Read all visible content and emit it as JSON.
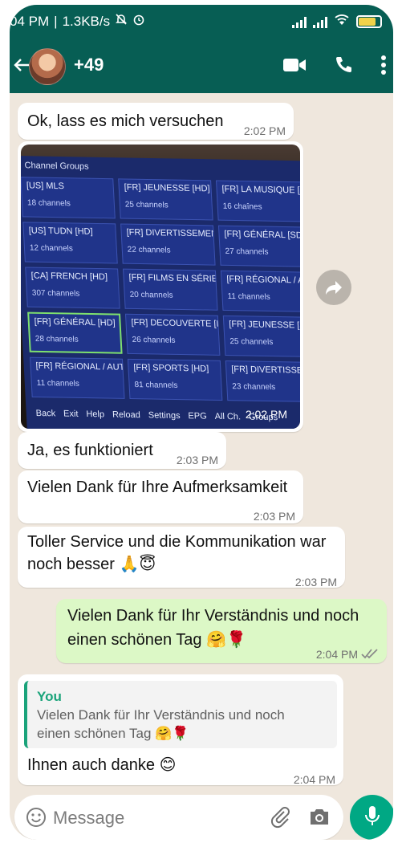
{
  "status": {
    "time": "04 PM",
    "speed": "1.3KB/s",
    "icons": [
      "mute-icon",
      "alarm-icon",
      "signal-icon",
      "signal-icon",
      "wifi-icon",
      "battery-icon"
    ]
  },
  "header": {
    "contact_name": "+49",
    "icons": [
      "back-icon",
      "video-call-icon",
      "voice-call-icon",
      "more-icon"
    ]
  },
  "messages": [
    {
      "text": "Ok, lass es mich versuchen",
      "time": "2:02 PM"
    },
    {
      "text": "Ja, es funktioniert",
      "time": "2:03 PM"
    },
    {
      "text": "Vielen Dank für Ihre Aufmerksamkeit",
      "time": "2:03 PM"
    },
    {
      "line1": "Toller Service und die Kommunikation war",
      "line2": "noch besser 🙏😇",
      "time": "2:03 PM"
    },
    {
      "line1": "Vielen Dank für Ihr Verständnis und noch",
      "line2": "einen schönen Tag 🤗🌹",
      "time": "2:04 PM"
    },
    {
      "quote_author": "You",
      "quote_line1": "Vielen Dank für Ihr Verständnis und noch",
      "quote_line2": "einen schönen Tag 🤗🌹",
      "text": "Ihnen auch danke 😊",
      "time": "2:04 PM"
    }
  ],
  "media": {
    "time": "2:02 PM",
    "tv_title": "Channel Groups",
    "rows": [
      [
        {
          "name": "[US] MLS",
          "count": "18 channels"
        },
        {
          "name": "[FR] JEUNESSE [HD]",
          "count": "25 channels"
        },
        {
          "name": "[FR] LA MUSIQUE [H",
          "count": "16 chaînes"
        }
      ],
      [
        {
          "name": "[US] TUDN [HD]",
          "count": "12 channels"
        },
        {
          "name": "[FR] DIVERTISSEMEN",
          "count": "22 channels"
        },
        {
          "name": "[FR] GÉNÉRAL [SD]",
          "count": "27 channels"
        }
      ],
      [
        {
          "name": "[CA] FRENCH [HD]",
          "count": "307 channels"
        },
        {
          "name": "[FR] FILMS EN SÉRIE",
          "count": "20 channels"
        },
        {
          "name": "[FR] RÉGIONAL / AUT",
          "count": "11 channels"
        }
      ],
      [
        {
          "name": "[FR] GÉNÉRAL [HD]",
          "count": "28 channels"
        },
        {
          "name": "[FR] DECOUVERTE [H",
          "count": "26 channels"
        },
        {
          "name": "[FR] JEUNESSE [SD]",
          "count": "25 channels"
        }
      ],
      [
        {
          "name": "[FR] RÉGIONAL / AUT",
          "count": "11 channels"
        },
        {
          "name": "[FR] SPORTS [HD]",
          "count": "81 channels"
        },
        {
          "name": "[FR] DIVERTISSEMEN",
          "count": "23 channels"
        }
      ]
    ],
    "footer": [
      "Back",
      "Exit",
      "Help",
      "Reload",
      "Settings",
      "EPG",
      "All Ch.",
      "Groups"
    ]
  },
  "composer": {
    "placeholder": "Message",
    "icons": [
      "emoji-icon",
      "attach-icon",
      "camera-icon",
      "mic-icon"
    ]
  },
  "colors": {
    "header": "#075e54",
    "chat_bg": "#efe7dd",
    "outgoing": "#dcf8c6",
    "accent": "#00a884"
  }
}
